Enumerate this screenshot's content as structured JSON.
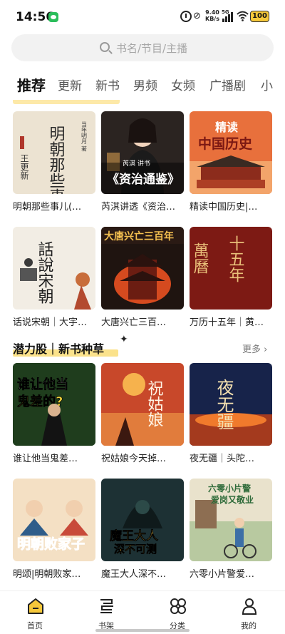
{
  "status_bar": {
    "time": "14:56",
    "net_speed_value": "9.40",
    "net_speed_unit": "KB/s",
    "signal_label": "5G",
    "battery": "100"
  },
  "search": {
    "placeholder": "书名/节目/主播"
  },
  "tabs": [
    {
      "label": "推荐",
      "active": true
    },
    {
      "label": "更新"
    },
    {
      "label": "新书"
    },
    {
      "label": "男频"
    },
    {
      "label": "女频"
    },
    {
      "label": "广播剧"
    },
    {
      "label": "小"
    }
  ],
  "books_row1": [
    {
      "title": "明朝那些事儿(…",
      "cover_text": "明朝那些事儿",
      "author_text": "当年明月 著",
      "extra_text": "王更新"
    },
    {
      "title": "芮淇讲透《资治…",
      "cover_text": "《资治通鉴》",
      "extra_text": "芮淇 讲书"
    },
    {
      "title": "精读中国历史|…",
      "cover_text": "精读中国历史"
    }
  ],
  "books_row2": [
    {
      "title": "话说宋朝｜大宇…",
      "cover_text": "話說宋朝"
    },
    {
      "title": "大唐兴亡三百…",
      "cover_text": "大唐兴亡三百年"
    },
    {
      "title": "万历十五年｜黄…",
      "cover_text": "萬曆十五年"
    }
  ],
  "section2": {
    "title": "潜力股｜新书种草",
    "more": "更多 ›"
  },
  "books_row3": [
    {
      "title": "谁让他当鬼差…",
      "cover_text": "谁让他当鬼差的?"
    },
    {
      "title": "祝姑娘今天掉…",
      "cover_text": "祝姑娘"
    },
    {
      "title": "夜无疆｜头陀…",
      "cover_text": "夜无疆"
    }
  ],
  "books_row4": [
    {
      "title": "明颂|明朝败家…",
      "cover_text": "明朝败家子"
    },
    {
      "title": "魔王大人深不…",
      "cover_text": "魔王大人深不可测"
    },
    {
      "title": "六零小片警爱…",
      "cover_text": "六零小片警爱岗又敬业"
    }
  ],
  "bottom_nav": [
    {
      "label": "首页",
      "active": true
    },
    {
      "label": "书架"
    },
    {
      "label": "分类"
    },
    {
      "label": "我的"
    }
  ],
  "colors": {
    "accent": "#f6c83a",
    "highlight": "#fbe28b"
  }
}
